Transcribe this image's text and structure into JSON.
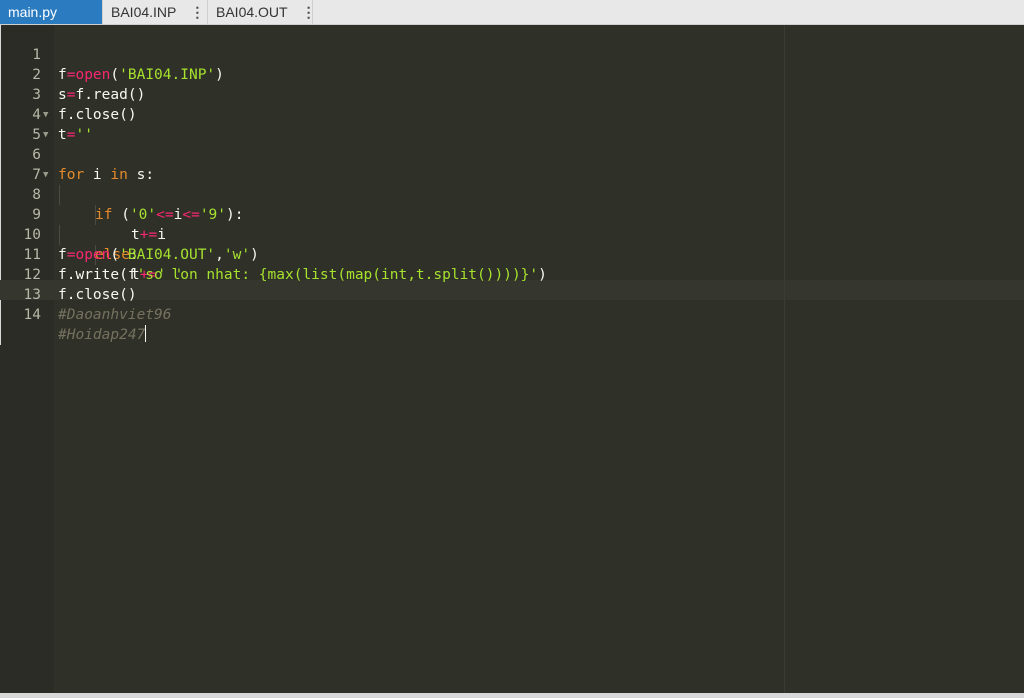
{
  "tabs": [
    {
      "label": "main.py",
      "active": true
    },
    {
      "label": "BAI04.INP",
      "active": false,
      "menu": "⋮"
    },
    {
      "label": "BAI04.OUT",
      "active": false,
      "menu": "⋮"
    }
  ],
  "editor": {
    "theme_colors": {
      "background": "#2f3129",
      "keyword": "#f92672",
      "string": "#a6e22e",
      "comment": "#75715e",
      "control": "#e58a2a"
    },
    "line_numbers": [
      "1",
      "2",
      "3",
      "4",
      "5",
      "6",
      "7",
      "8",
      "9",
      "10",
      "11",
      "12",
      "13",
      "14"
    ],
    "code": {
      "l1": {
        "a": "f",
        "op": "=",
        "fn": "open",
        "b": "(",
        "s": "'BAI04.INP'",
        "c": ")"
      },
      "l2": {
        "a": "s",
        "op": "=",
        "b": "f.read()"
      },
      "l3": {
        "a": "f.close()"
      },
      "l4": {
        "a": "t",
        "op": "=",
        "s": "''"
      },
      "l5": {
        "kw1": "for",
        "a": " i ",
        "kw2": "in",
        "b": " s:"
      },
      "l6": {
        "kw": "if",
        "a": " (",
        "s1": "'0'",
        "op1": "<=",
        "b": "i",
        "op2": "<=",
        "s2": "'9'",
        "c": "):"
      },
      "l7": {
        "a": "t",
        "op": "+=",
        "b": "i"
      },
      "l8": {
        "kw": "else",
        "a": ":"
      },
      "l9": {
        "a": "t",
        "op": "+=",
        "s": "' '"
      },
      "l10": {
        "a": "f",
        "op": "=",
        "fn": "open",
        "b": "(",
        "s1": "'BAI04.OUT'",
        "c": ",",
        "s2": "'w'",
        "d": ")"
      },
      "l11": {
        "a": "f.write(f",
        "s": "'so lon nhat: {max(list(map(int,t.split())))}'",
        "b": ")"
      },
      "l12": {
        "a": "f.close()"
      },
      "l13": {
        "cmt": "#Daoanhviet96"
      },
      "l14": {
        "cmt": "#Hoidap247"
      }
    }
  }
}
